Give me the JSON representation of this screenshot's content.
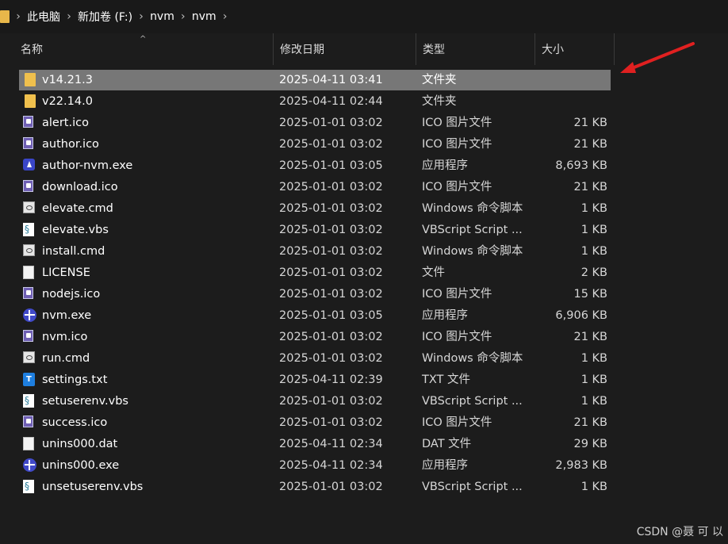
{
  "breadcrumb": [
    "此电脑",
    "新加卷 (F:)",
    "nvm",
    "nvm"
  ],
  "columns": {
    "name": "名称",
    "date": "修改日期",
    "type": "类型",
    "size": "大小"
  },
  "files": [
    {
      "name": "v14.21.3",
      "date": "2025-04-11 03:41",
      "type": "文件夹",
      "size": "",
      "icon": "folder-icon",
      "selected": true
    },
    {
      "name": "v22.14.0",
      "date": "2025-04-11 02:44",
      "type": "文件夹",
      "size": "",
      "icon": "folder-icon"
    },
    {
      "name": "alert.ico",
      "date": "2025-01-01 03:02",
      "type": "ICO 图片文件",
      "size": "21 KB",
      "icon": "ico-image-icon"
    },
    {
      "name": "author.ico",
      "date": "2025-01-01 03:02",
      "type": "ICO 图片文件",
      "size": "21 KB",
      "icon": "ico-image-icon"
    },
    {
      "name": "author-nvm.exe",
      "date": "2025-01-01 03:05",
      "type": "应用程序",
      "size": "8,693 KB",
      "icon": "author-exe-icon"
    },
    {
      "name": "download.ico",
      "date": "2025-01-01 03:02",
      "type": "ICO 图片文件",
      "size": "21 KB",
      "icon": "ico-image-icon"
    },
    {
      "name": "elevate.cmd",
      "date": "2025-01-01 03:02",
      "type": "Windows 命令脚本",
      "size": "1 KB",
      "icon": "cmd-script-icon"
    },
    {
      "name": "elevate.vbs",
      "date": "2025-01-01 03:02",
      "type": "VBScript Script ...",
      "size": "1 KB",
      "icon": "vbscript-icon"
    },
    {
      "name": "install.cmd",
      "date": "2025-01-01 03:02",
      "type": "Windows 命令脚本",
      "size": "1 KB",
      "icon": "cmd-script-icon"
    },
    {
      "name": "LICENSE",
      "date": "2025-01-01 03:02",
      "type": "文件",
      "size": "2 KB",
      "icon": "blank-file-icon"
    },
    {
      "name": "nodejs.ico",
      "date": "2025-01-01 03:02",
      "type": "ICO 图片文件",
      "size": "15 KB",
      "icon": "ico-image-icon"
    },
    {
      "name": "nvm.exe",
      "date": "2025-01-01 03:05",
      "type": "应用程序",
      "size": "6,906 KB",
      "icon": "nvm-exe-icon"
    },
    {
      "name": "nvm.ico",
      "date": "2025-01-01 03:02",
      "type": "ICO 图片文件",
      "size": "21 KB",
      "icon": "ico-image-icon"
    },
    {
      "name": "run.cmd",
      "date": "2025-01-01 03:02",
      "type": "Windows 命令脚本",
      "size": "1 KB",
      "icon": "cmd-script-icon"
    },
    {
      "name": "settings.txt",
      "date": "2025-04-11 02:39",
      "type": "TXT 文件",
      "size": "1 KB",
      "icon": "text-file-icon"
    },
    {
      "name": "setuserenv.vbs",
      "date": "2025-01-01 03:02",
      "type": "VBScript Script ...",
      "size": "1 KB",
      "icon": "vbscript-icon"
    },
    {
      "name": "success.ico",
      "date": "2025-01-01 03:02",
      "type": "ICO 图片文件",
      "size": "21 KB",
      "icon": "ico-image-icon"
    },
    {
      "name": "unins000.dat",
      "date": "2025-04-11 02:34",
      "type": "DAT 文件",
      "size": "29 KB",
      "icon": "blank-file-icon"
    },
    {
      "name": "unins000.exe",
      "date": "2025-04-11 02:34",
      "type": "应用程序",
      "size": "2,983 KB",
      "icon": "nvm-exe-icon"
    },
    {
      "name": "unsetuserenv.vbs",
      "date": "2025-01-01 03:02",
      "type": "VBScript Script ...",
      "size": "1 KB",
      "icon": "vbscript-icon"
    }
  ],
  "watermark": "CSDN @聂 可 以",
  "colors": {
    "background": "#1c1c1c",
    "selected_row": "#777777",
    "arrow": "#e02020"
  }
}
